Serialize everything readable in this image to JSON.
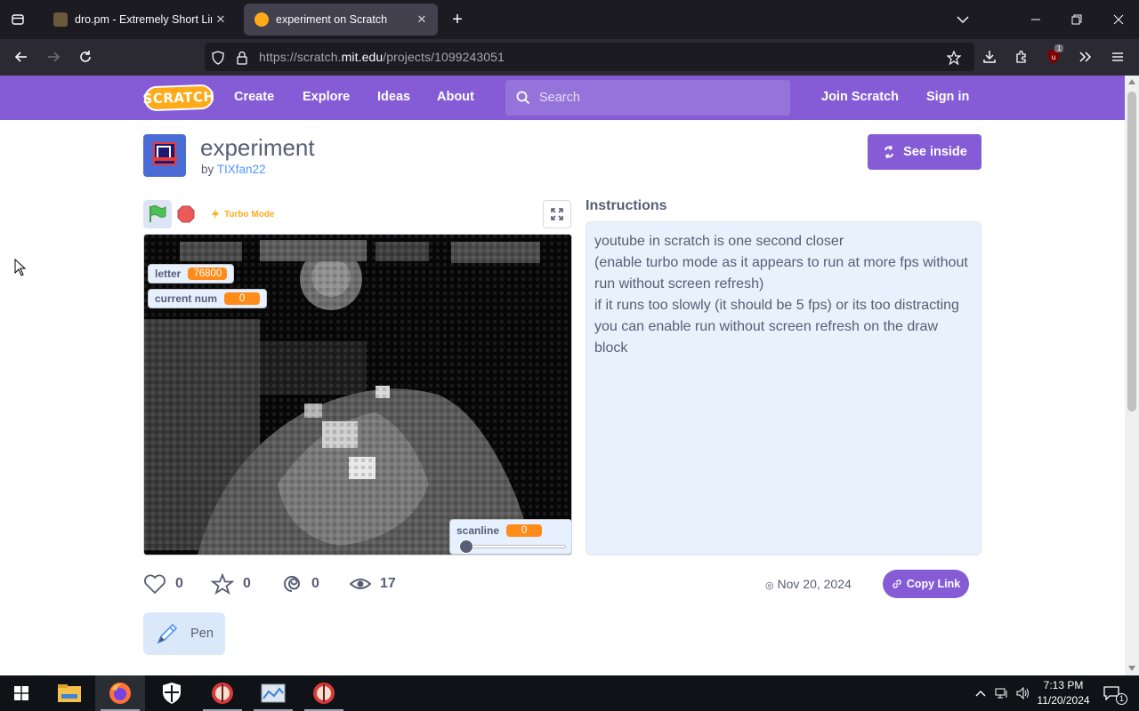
{
  "browser": {
    "tabs": [
      {
        "title": "dro.pm - Extremely Short Links",
        "active": false
      },
      {
        "title": "experiment on Scratch",
        "active": true
      }
    ],
    "url": {
      "scheme": "https://scratch.",
      "host": "mit.edu",
      "path": "/projects/1099243051"
    },
    "extension_badge": "1"
  },
  "scratch_nav": {
    "logo_text": "SCRATCH",
    "links": [
      "Create",
      "Explore",
      "Ideas",
      "About"
    ],
    "search_placeholder": "Search",
    "join": "Join Scratch",
    "signin": "Sign in"
  },
  "project": {
    "title": "experiment",
    "by_prefix": "by",
    "author": "TIXfan22",
    "see_inside": "See inside",
    "turbo_mode": "Turbo Mode",
    "monitors": {
      "letter": {
        "label": "letter",
        "value": "76800"
      },
      "current_num": {
        "label": "current num",
        "value": "0"
      },
      "scanline": {
        "label": "scanline",
        "value": "0"
      }
    },
    "instructions_label": "Instructions",
    "instructions": [
      "youtube in scratch is one second closer",
      "(enable turbo mode as it appears to run at more fps without",
      "run without screen refresh)",
      "if it runs too slowly (it should be 5 fps) or its too distracting",
      "you can enable run without screen refresh on the draw",
      "block"
    ],
    "stats": {
      "loves": "0",
      "favorites": "0",
      "remixes": "0",
      "views": "17"
    },
    "date": "Nov 20, 2024",
    "copy_link": "Copy Link",
    "extension": "Pen"
  },
  "taskbar": {
    "time": "7:13 PM",
    "date": "11/20/2024",
    "notification_count": "1"
  },
  "colors": {
    "scratch_purple": "#855cd6",
    "monitor_orange": "#ff8c1a",
    "text": "#575e75",
    "link_blue": "#4d97ff"
  }
}
